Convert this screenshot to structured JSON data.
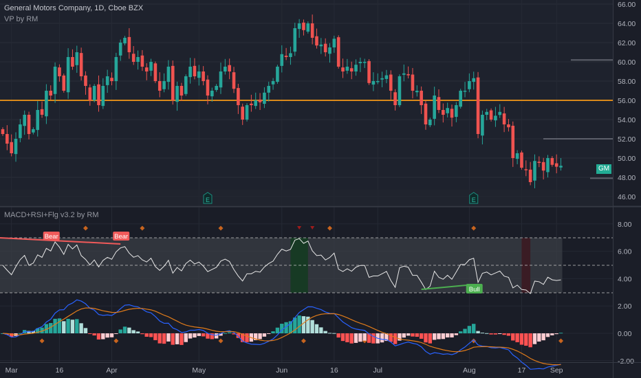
{
  "header": {
    "title": "General Motors Company, 1D, Cboe BZX",
    "indicator1": "VP by RM",
    "indicator2": "MACD+RSI+Flg v3.2 by RM"
  },
  "symbol_badge": "GM",
  "price_axis": [
    "66.00",
    "64.00",
    "62.00",
    "60.00",
    "58.00",
    "56.00",
    "54.00",
    "52.00",
    "50.00",
    "48.00",
    "46.00"
  ],
  "osc_axis": [
    "8.00",
    "6.00",
    "4.00",
    "2.00",
    "0.00",
    "-2.00"
  ],
  "time_axis": [
    {
      "label": "Mar",
      "index": 2
    },
    {
      "label": "16",
      "index": 13
    },
    {
      "label": "Apr",
      "index": 25
    },
    {
      "label": "May",
      "index": 45
    },
    {
      "label": "Jun",
      "index": 64
    },
    {
      "label": "16",
      "index": 76
    },
    {
      "label": "Jul",
      "index": 86
    },
    {
      "label": "Aug",
      "index": 107
    },
    {
      "label": "17",
      "index": 119
    },
    {
      "label": "Sep",
      "index": 127
    }
  ],
  "colors": {
    "up": "#26a69a",
    "down": "#ef5350",
    "poc": "#d9891a",
    "rsi": "#e8e8e8",
    "macd": "#2962ff",
    "signal": "#e07b1a",
    "bull": "#4caf50",
    "bear": "#f05a5a"
  },
  "volume_profile": {
    "poc_price": 56.0,
    "levels": [
      60.2,
      52.0,
      47.9
    ]
  },
  "closes": [
    52.5,
    51.5,
    50.5,
    52,
    53.5,
    54.5,
    52.5,
    53,
    55,
    54.5,
    57,
    56.5,
    59.5,
    58.5,
    57,
    60.5,
    59.5,
    61,
    58.5,
    57.5,
    56,
    57.5,
    55.5,
    57.5,
    58.5,
    58,
    60.5,
    62,
    62.5,
    61,
    60,
    60.5,
    59.5,
    59,
    60,
    58,
    57,
    58,
    59.5,
    56,
    57.5,
    56.5,
    58.5,
    59.5,
    58.5,
    59,
    58,
    56.5,
    57,
    57.5,
    59,
    59.5,
    59,
    57.2,
    55.5,
    54,
    55.5,
    55.5,
    56,
    55.8,
    56.8,
    57.5,
    58,
    59.5,
    60.8,
    60.5,
    60.9,
    63.5,
    64,
    63.3,
    64,
    62.5,
    61.7,
    61.8,
    61,
    61.5,
    62.4,
    59.5,
    59,
    59.5,
    59,
    59.7,
    60,
    60,
    57.8,
    58,
    58,
    58.3,
    58.6,
    57,
    55.5,
    58.5,
    58.8,
    58.6,
    57,
    57,
    55.5,
    53.5,
    54,
    56.5,
    55,
    54.5,
    55.2,
    54.2,
    55.5,
    57,
    57,
    58,
    58.3,
    52.5,
    54.5,
    54.8,
    54,
    54.4,
    54.8,
    53.5,
    53.2,
    50,
    50.5,
    49,
    48.8,
    47.5,
    49.7,
    49.5,
    48.7,
    50,
    49.3,
    49.1,
    49.2
  ],
  "earnings": [
    {
      "label": "E",
      "index": 47
    },
    {
      "label": "E",
      "index": 108
    }
  ],
  "signals": {
    "top_diamonds": [
      19,
      32,
      50,
      75,
      108
    ],
    "top_red_markers": [
      68,
      71
    ],
    "bottom_diamonds": [
      9,
      26,
      50,
      69,
      83,
      108,
      128
    ],
    "bear_labels": [
      {
        "label": "Bear",
        "index": 11
      },
      {
        "label": "Bear",
        "index": 27
      }
    ],
    "bull_labels": [
      {
        "label": "Bull",
        "index": 108
      }
    ],
    "overbought_zone": [
      66,
      70
    ],
    "oversold_zone": [
      119,
      121
    ]
  }
}
